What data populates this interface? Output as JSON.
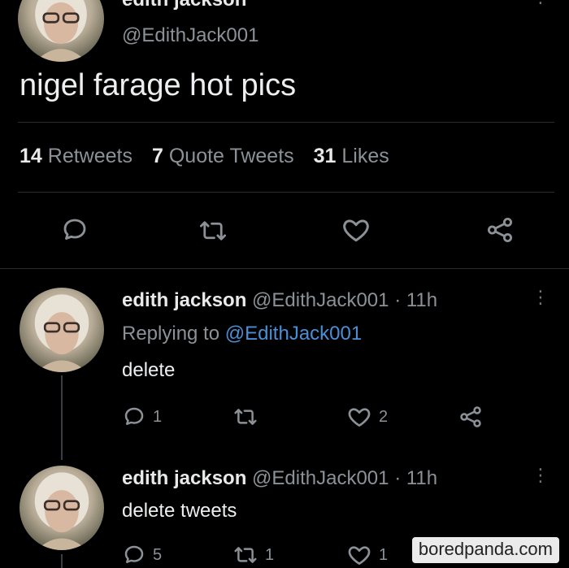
{
  "main_tweet": {
    "display_name": "edith jackson",
    "handle": "@EdithJack001",
    "text": "nigel farage hot pics",
    "stats": {
      "retweets_count": "14",
      "retweets_label": "Retweets",
      "quotes_count": "7",
      "quotes_label": "Quote Tweets",
      "likes_count": "31",
      "likes_label": "Likes"
    }
  },
  "replies": [
    {
      "display_name": "edith jackson",
      "handle": "@EdithJack001",
      "time": "· 11h",
      "replying_prefix": "Replying to",
      "replying_handle": "@EdithJack001",
      "text": "delete",
      "reply_count": "1",
      "retweet_count": "",
      "like_count": "2"
    },
    {
      "display_name": "edith jackson",
      "handle": "@EdithJack001",
      "time": "· 11h",
      "text": "delete tweets",
      "reply_count": "5",
      "retweet_count": "1",
      "like_count": "1"
    }
  ],
  "icons": {
    "reply": "reply-icon",
    "retweet": "retweet-icon",
    "like": "heart-icon",
    "share": "share-icon",
    "more": "more-icon"
  },
  "colors": {
    "background": "#000000",
    "text": "#e7e9ea",
    "muted": "#8b9197",
    "link": "#4a8fd6"
  },
  "watermark": "boredpanda.com"
}
